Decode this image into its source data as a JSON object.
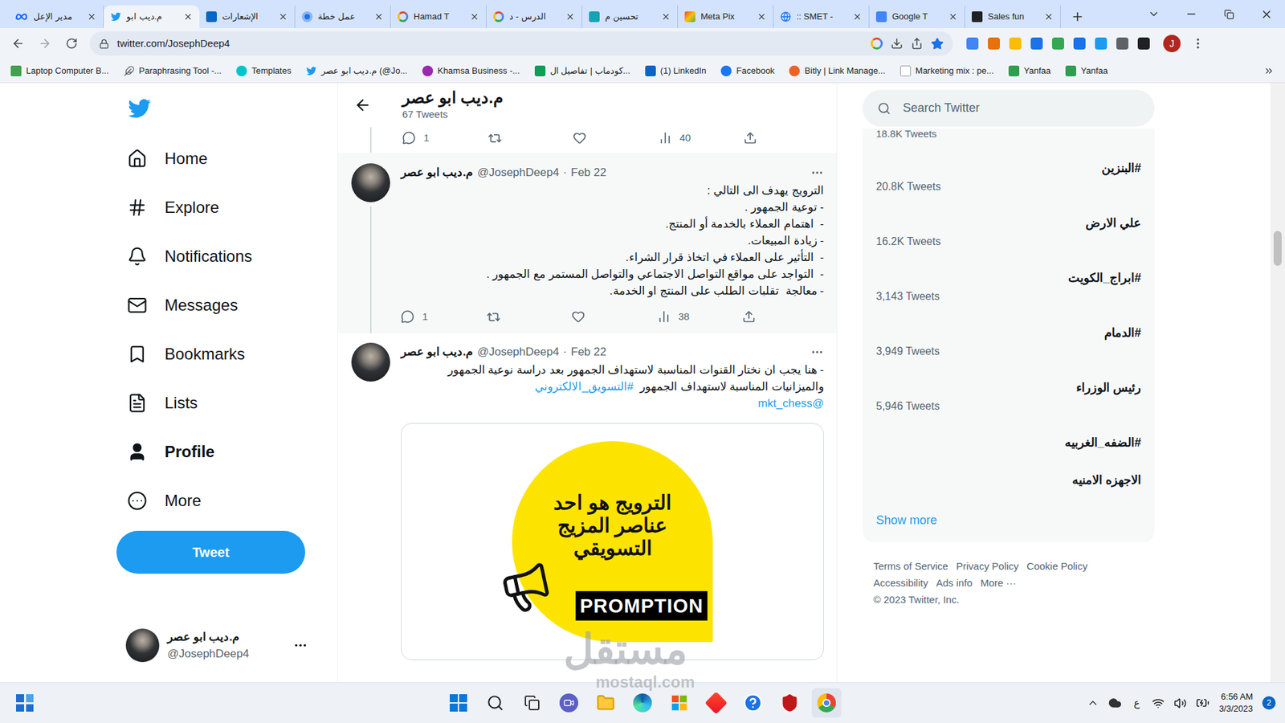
{
  "browser": {
    "tabs": [
      {
        "title": "مدير الإعل",
        "kind": "meta",
        "selected": false
      },
      {
        "title": "م.ديب ابو",
        "kind": "twitter",
        "selected": true
      },
      {
        "title": "الإشعارات",
        "kind": "linkedin",
        "selected": false
      },
      {
        "title": "عمل خطة",
        "kind": "circle",
        "selected": false
      },
      {
        "title": "Hamad T",
        "kind": "google",
        "selected": false
      },
      {
        "title": "الدرس - د",
        "kind": "google",
        "selected": false
      },
      {
        "title": "تحسين م",
        "kind": "teal",
        "selected": false
      },
      {
        "title": "Meta Pix",
        "kind": "pixel",
        "selected": false
      },
      {
        "title": ":: SMET -",
        "kind": "globe",
        "selected": false
      },
      {
        "title": "Google T",
        "kind": "translate",
        "selected": false
      },
      {
        "title": "Sales fun",
        "kind": "dark",
        "selected": false
      }
    ],
    "address": "twitter.com/JosephDeep4",
    "profile_initial": "J",
    "bookmarks": [
      {
        "label": "Laptop Computer B...",
        "kind": "px"
      },
      {
        "label": "Paraphrasing Tool -...",
        "kind": "tool"
      },
      {
        "label": "Templates",
        "kind": "canva"
      },
      {
        "label": "م.ديب ابو عصر (@Jo...",
        "kind": "twitter"
      },
      {
        "label": "Khamsa Business -...",
        "kind": "podcast"
      },
      {
        "label": "كودماب | تفاصيل ال...",
        "kind": "codemap"
      },
      {
        "label": "(1) LinkedIn",
        "kind": "linkedin"
      },
      {
        "label": "Facebook",
        "kind": "facebook"
      },
      {
        "label": "Bitly | Link Manage...",
        "kind": "bitly"
      },
      {
        "label": "Marketing mix : pe...",
        "kind": "doc"
      },
      {
        "label": "Yanfaa",
        "kind": "yanfaa"
      },
      {
        "label": "Yanfaa",
        "kind": "yanfaa"
      }
    ]
  },
  "twitter": {
    "nav": [
      {
        "label": "Home",
        "selected": false
      },
      {
        "label": "Explore",
        "selected": false
      },
      {
        "label": "Notifications",
        "selected": false
      },
      {
        "label": "Messages",
        "selected": false
      },
      {
        "label": "Bookmarks",
        "selected": false
      },
      {
        "label": "Lists",
        "selected": false
      },
      {
        "label": "Profile",
        "selected": true
      },
      {
        "label": "More",
        "selected": false
      }
    ],
    "tweet_button": "Tweet",
    "account": {
      "name": "م.ديب ابو عصر",
      "handle": "@JosephDeep4"
    },
    "header": {
      "name": "م.ديب ابو عصر",
      "count": "67 Tweets"
    },
    "previous_tweet": {
      "replies": "1",
      "views": "40"
    },
    "tweets": [
      {
        "name": "م.ديب ابو عصر",
        "handle": "@JosephDeep4",
        "separator": "·",
        "date": "Feb 22",
        "highlighted": true,
        "lines": [
          "الترويج يهدف الى التالي :",
          "- توعية الجمهور .",
          "-  اهتمام العملاء بالخدمة أو المنتج.",
          "- زيادة المبيعات.",
          "-  التأثير على العملاء في اتخاذ قرار الشراء.",
          "-  التواجد على مواقع التواصل الاجتماعي والتواصل المستمر مع الجمهور .",
          "- معالجة  تقلبات الطلب على المنتج او الخدمة."
        ],
        "replies": "1",
        "views": "38",
        "hashtag": null,
        "mention": null,
        "image": null
      },
      {
        "name": "م.ديب ابو عصر",
        "handle": "@JosephDeep4",
        "separator": "·",
        "date": "Feb 22",
        "highlighted": false,
        "lines": [
          "- هنا يجب ان نختار القنوات المناسبة لاستهداف الجمهور بعد دراسة نوعية الجمهور والميزانيات المناسبة لاستهداف الجمهور"
        ],
        "replies": null,
        "views": null,
        "hashtag": "#التسويق_الالكتروني",
        "mention": "@mkt_chess",
        "image": {
          "lines": [
            "الترويج هو احد",
            "عناصر المزيج",
            "التسويقي"
          ],
          "label": "PROMPTION"
        }
      }
    ],
    "search_placeholder": "Search Twitter",
    "trends_cut_count": "18.8K Tweets",
    "trends": [
      {
        "name": "#البنزين",
        "count": "20.8K Tweets"
      },
      {
        "name": "علي الارض",
        "count": "16.2K Tweets"
      },
      {
        "name": "#ابراج_الكويت",
        "count": "3,143 Tweets"
      },
      {
        "name": "#الدمام",
        "count": "3,949 Tweets"
      },
      {
        "name": "رئيس الوزراء",
        "count": "5,946 Tweets"
      },
      {
        "name": "#الضفه_الغربيه",
        "count": null
      },
      {
        "name": "الاجهزه الامنيه",
        "count": null
      }
    ],
    "show_more": "Show more",
    "footer": [
      "Terms of Service",
      "Privacy Policy",
      "Cookie Policy",
      "Accessibility",
      "Ads info",
      "More ···"
    ],
    "copyright": "© 2023 Twitter, Inc."
  },
  "watermark": {
    "arabic": "مستقل",
    "latin": "mostaql.com"
  },
  "scrollbar": {
    "position": 0.247,
    "size": 0.058
  },
  "taskbar": {
    "language": "ع",
    "time": "6:56 AM",
    "date": "3/3/2023",
    "notifications": "2"
  }
}
